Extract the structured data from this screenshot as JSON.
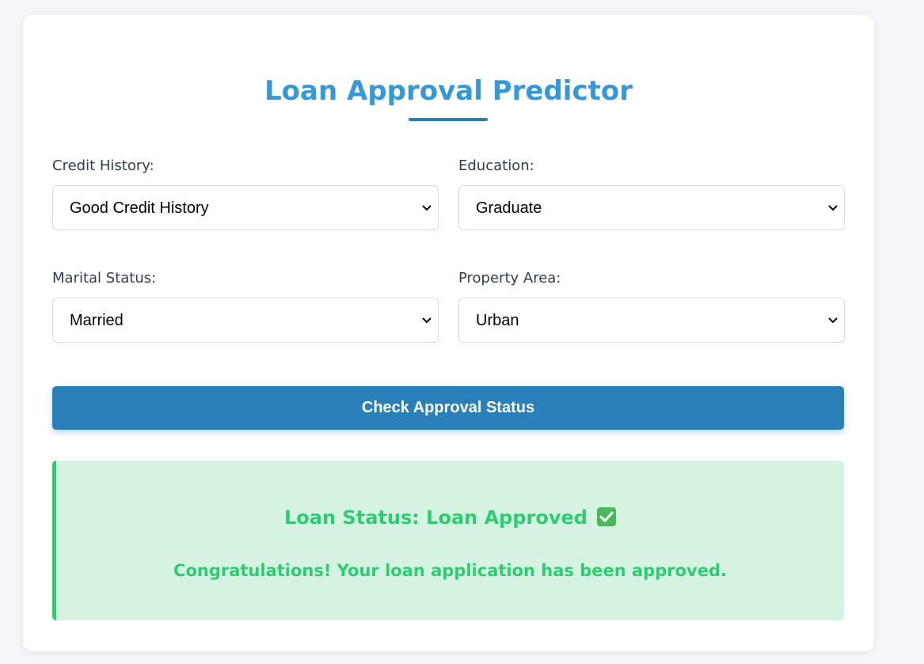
{
  "header": {
    "title": "Loan Approval Predictor"
  },
  "form": {
    "credit_history": {
      "label": "Credit History:",
      "value": "Good Credit History"
    },
    "education": {
      "label": "Education:",
      "value": "Graduate"
    },
    "marital_status": {
      "label": "Marital Status:",
      "value": "Married"
    },
    "property_area": {
      "label": "Property Area:",
      "value": "Urban"
    },
    "submit_label": "Check Approval Status"
  },
  "result": {
    "status_text": "Loan Status: Loan Approved",
    "status_icon": "check-mark-icon",
    "message": "Congratulations! Your loan application has been approved."
  },
  "colors": {
    "accent": "#2980b9",
    "title": "#3498db",
    "success": "#2ecc71",
    "success_bg": "#d4f4e1"
  }
}
